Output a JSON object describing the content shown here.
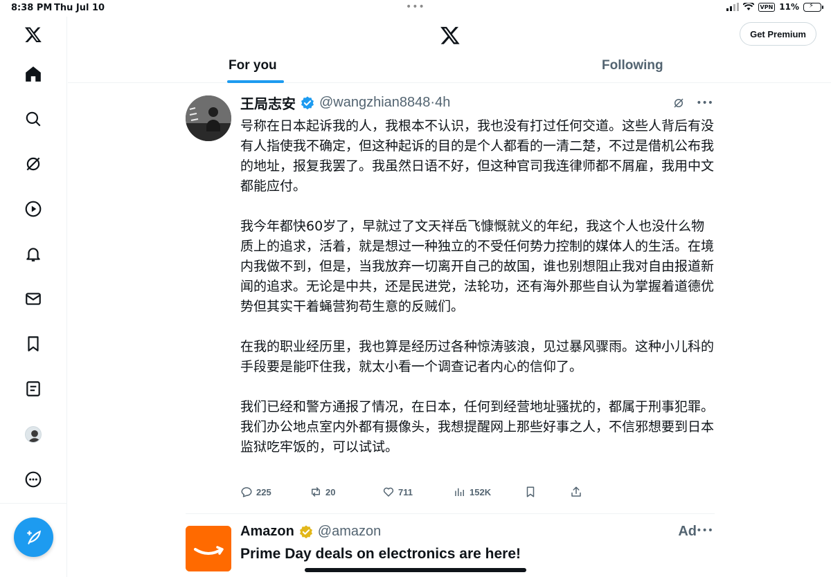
{
  "status_bar": {
    "time": "8:38 PM",
    "date": "Thu Jul 10",
    "vpn": "VPN",
    "battery": "11%"
  },
  "header": {
    "premium_label": "Get Premium",
    "tabs": [
      {
        "label": "For you",
        "active": true
      },
      {
        "label": "Following",
        "active": false
      }
    ]
  },
  "tweet": {
    "name": "王局志安",
    "handle": "@wangzhian8848",
    "time": "·4h",
    "paragraphs": [
      "号称在日本起诉我的人，我根本不认识，我也没有打过任何交道。这些人背后有没有人指使我不确定，但这种起诉的目的是个人都看的一清二楚，不过是借机公布我的地址，报复我罢了。我虽然日语不好，但这种官司我连律师都不屑雇，我用中文都能应付。",
      "我今年都快60岁了，早就过了文天祥岳飞慷慨就义的年纪，我这个人也没什么物质上的追求，活着，就是想过一种独立的不受任何势力控制的媒体人的生活。在境内我做不到，但是，当我放弃一切离开自己的故国，谁也别想阻止我对自由报道新闻的追求。无论是中共，还是民进党，法轮功，还有海外那些自认为掌握着道德优势但其实干着蝇营狗苟生意的反贼们。",
      "在我的职业经历里，我也算是经历过各种惊涛骇浪，见过暴风骤雨。这种小儿科的手段要是能吓住我，就太小看一个调查记者内心的信仰了。",
      "我们已经和警方通报了情况，在日本，任何到经营地址骚扰的，都属于刑事犯罪。我们办公地点室内外都有摄像头，我想提醒网上那些好事之人，不信邪想要到日本监狱吃牢饭的，可以试试。"
    ],
    "stats": {
      "replies": "225",
      "retweets": "20",
      "likes": "711",
      "views": "152K"
    }
  },
  "ad": {
    "name": "Amazon",
    "handle": "@amazon",
    "tag": "Ad",
    "text": "Prime Day deals on electronics are here!"
  },
  "colors": {
    "accent": "#1d9bf0",
    "secondary_text": "#536471",
    "gold_badge": "#e2b719",
    "amazon_orange": "#ff9900"
  },
  "icons": {
    "sidebar": [
      "x-logo-icon",
      "home-icon",
      "search-icon",
      "grok-icon",
      "video-icon",
      "notifications-icon",
      "messages-icon",
      "bookmarks-icon",
      "lists-icon",
      "profile-avatar",
      "more-icon"
    ],
    "compose": "compose-feather-icon"
  }
}
